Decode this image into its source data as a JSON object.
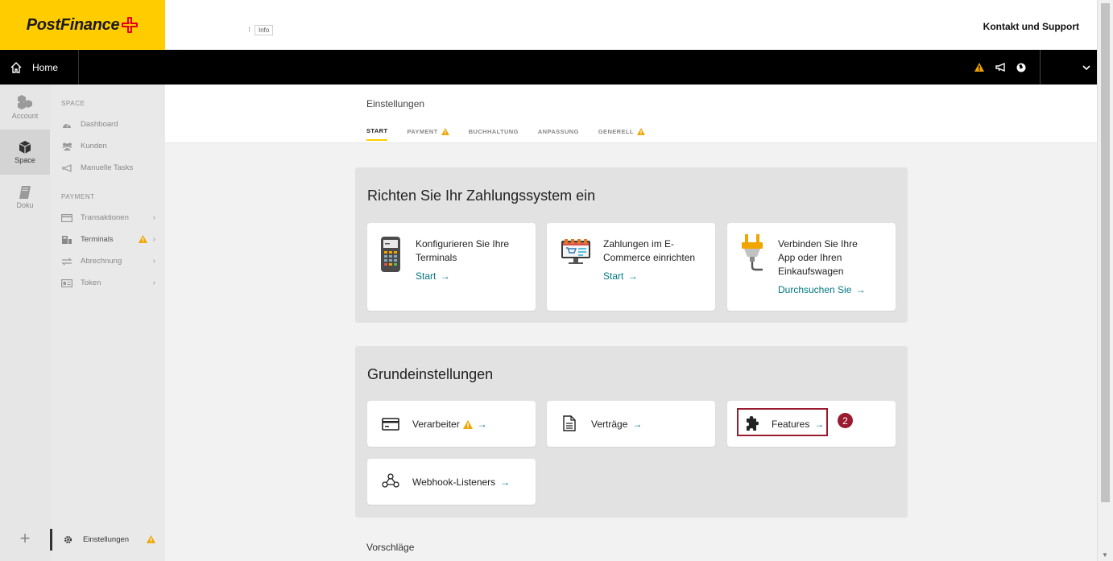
{
  "brand": {
    "name": "PostFinance",
    "accent": "#ffcc00",
    "cross_color": "#e3001b"
  },
  "topbar": {
    "info_tag": "Info",
    "support_label": "Kontakt und Support"
  },
  "nav": {
    "home_label": "Home",
    "icons": [
      "warning-icon",
      "megaphone-icon",
      "globe-icon"
    ]
  },
  "rail": {
    "items": [
      {
        "label": "Account",
        "icon": "account-icon"
      },
      {
        "label": "Space",
        "icon": "space-icon",
        "active": true
      },
      {
        "label": "Doku",
        "icon": "book-icon"
      }
    ],
    "add_icon": "plus-icon"
  },
  "sidebar": {
    "space_section": "SPACE",
    "space_items": [
      {
        "label": "Dashboard",
        "icon": "dashboard-icon"
      },
      {
        "label": "Kunden",
        "icon": "users-icon"
      },
      {
        "label": "Manuelle Tasks",
        "icon": "megaphone-icon"
      }
    ],
    "payment_section": "PAYMENT",
    "payment_items": [
      {
        "label": "Transaktionen",
        "icon": "card-icon"
      },
      {
        "label": "Terminals",
        "icon": "terminal-icon"
      },
      {
        "label": "Abrechnung",
        "icon": "exchange-icon"
      },
      {
        "label": "Token",
        "icon": "token-icon"
      }
    ],
    "settings_label": "Einstellungen"
  },
  "main": {
    "title": "Einstellungen",
    "tabs": [
      {
        "label": "START",
        "active": true
      },
      {
        "label": "PAYMENT",
        "warning": true
      },
      {
        "label": "BUCHHALTUNG"
      },
      {
        "label": "ANPASSUNG"
      },
      {
        "label": "GENERELL",
        "warning": true
      }
    ]
  },
  "setup_panel": {
    "title": "Richten Sie Ihr Zahlungssystem ein",
    "cards": [
      {
        "title_lines": [
          "Konfigurieren Sie Ihre",
          "Terminals"
        ],
        "link": "Start",
        "icon": "pos-terminal-icon"
      },
      {
        "title_lines": [
          "Zahlungen im E-",
          "Commerce einrichten"
        ],
        "link": "Start",
        "icon": "webshop-icon"
      },
      {
        "title_lines": [
          "Verbinden Sie Ihre",
          "App oder Ihren",
          "Einkaufswagen"
        ],
        "link": "Durchsuchen Sie",
        "icon": "plug-icon"
      }
    ]
  },
  "basic_panel": {
    "title": "Grundeinstellungen",
    "cards": [
      {
        "label": "Verarbeiter",
        "icon": "card-icon",
        "warning": true
      },
      {
        "label": "Verträge",
        "icon": "document-icon"
      },
      {
        "label": "Features",
        "icon": "puzzle-icon",
        "highlighted": true,
        "badge": "2"
      },
      {
        "label": "Webhook-Listeners",
        "icon": "webhook-icon"
      }
    ]
  },
  "suggestions_label": "Vorschläge",
  "colors": {
    "link": "#00767f",
    "warning": "#f0a500",
    "highlight": "#9a1b2f"
  }
}
